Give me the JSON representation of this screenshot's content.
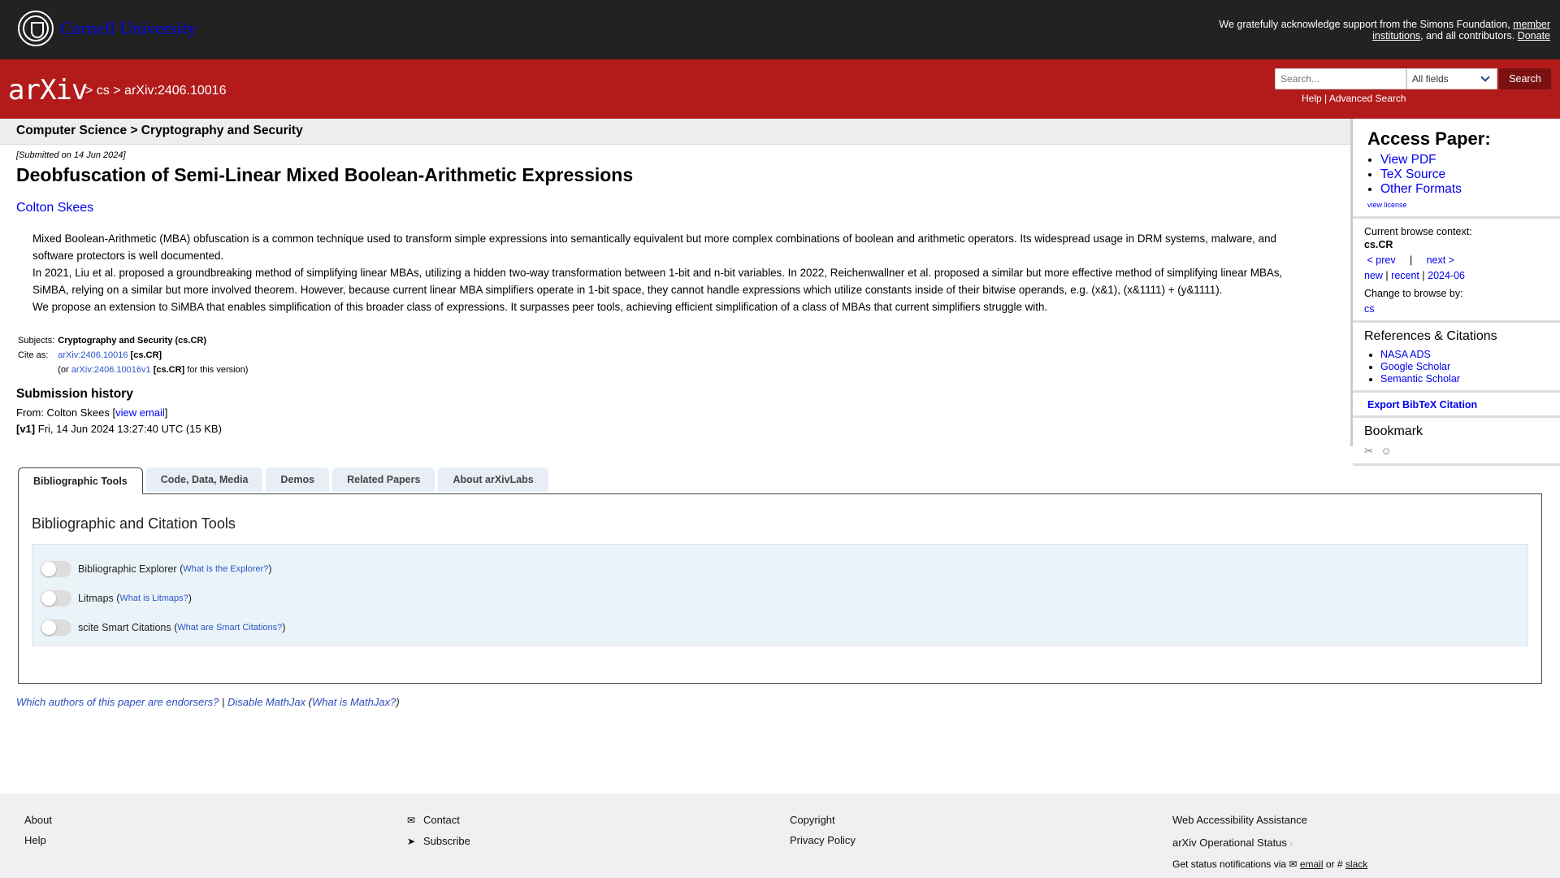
{
  "header": {
    "university": "Cornell University",
    "ack_text": "We gratefully acknowledge support from the Simons Foundation,",
    "ack_link1": "member institutions",
    "ack_mid": ", and all contributors.",
    "ack_donate": "Donate"
  },
  "topbar": {
    "logo": "arXiv",
    "crumb_sep1": ">",
    "crumb_cs": "cs",
    "crumb_sep2": ">",
    "crumb_id": "arXiv:2406.10016",
    "search_placeholder": "Search...",
    "search_field": "All fields",
    "search_button": "Search",
    "help": "Help",
    "help_sep": "|",
    "advanced": "Advanced Search"
  },
  "paper": {
    "category": "Computer Science > Cryptography and Security",
    "submitted": "[Submitted on 14 Jun 2024]",
    "title": "Deobfuscation of Semi-Linear Mixed Boolean-Arithmetic Expressions",
    "author": "Colton Skees",
    "abstract_p1": "Mixed Boolean-Arithmetic (MBA) obfuscation is a common technique used to transform simple expressions into semantically equivalent but more complex combinations of boolean and arithmetic operators. Its widespread usage in DRM systems, malware, and software protectors is well documented.",
    "abstract_p2": "In 2021, Liu et al. proposed a groundbreaking method of simplifying linear MBAs, utilizing a hidden two-way transformation between 1-bit and n-bit variables. In 2022, Reichenwallner et al. proposed a similar but more effective method of simplifying linear MBAs, SiMBA, relying on a similar but more involved theorem. However, because current linear MBA simplifiers operate in 1-bit space, they cannot handle expressions which utilize constants inside of their bitwise operands, e.g. (x&1), (x&1111) + (y&1111).",
    "abstract_p3": "We propose an extension to SiMBA that enables simplification of this broader class of expressions. It surpasses peer tools, achieving efficient simplification of a class of MBAs that current simplifiers struggle with.",
    "subjects_label": "Subjects:",
    "subjects_value": "Cryptography and Security (cs.CR)",
    "cite_label": "Cite as:",
    "cite_link": "arXiv:2406.10016",
    "cite_cat": "[cs.CR]",
    "cite_or_pre": "(or",
    "cite_version_link": "arXiv:2406.10016v1",
    "cite_version_cat": "[cs.CR]",
    "cite_or_post": "for this version)",
    "history_title": "Submission history",
    "history_from": "From: Colton Skees [",
    "history_view_email": "view email",
    "history_from_end": "]",
    "history_v1": "[v1]",
    "history_v1_text": "Fri, 14 Jun 2024 13:27:40 UTC (15 KB)"
  },
  "sidebar": {
    "access_title": "Access Paper:",
    "view_pdf": "View PDF",
    "tex_source": "TeX Source",
    "other_formats": "Other Formats",
    "view_license": "view license",
    "context_label": "Current browse context:",
    "context_value": "cs.CR",
    "prev": "< prev",
    "pipe": "|",
    "next": "next >",
    "new": "new",
    "recent": "recent",
    "date": "2024-06",
    "change_label": "Change to browse by:",
    "change_value": "cs",
    "refs_title": "References & Citations",
    "nasa": "NASA ADS",
    "google": "Google Scholar",
    "semantic": "Semantic Scholar",
    "bibtex": "Export BibTeX Citation",
    "bookmark": "Bookmark"
  },
  "tabs": {
    "items": [
      "Bibliographic Tools",
      "Code, Data, Media",
      "Demos",
      "Related Papers",
      "About arXivLabs"
    ],
    "panel_title": "Bibliographic and Citation Tools",
    "tool1": "Bibliographic Explorer",
    "tool1_link": "What is the Explorer?",
    "tool2": "Litmaps",
    "tool2_link": "What is Litmaps?",
    "tool3": "scite Smart Citations",
    "tool3_link": "What are Smart Citations?"
  },
  "endorse": {
    "link1": "Which authors of this paper are endorsers?",
    "sep": "|",
    "link2": "Disable MathJax",
    "link3": "What is MathJax?"
  },
  "footer": {
    "about": "About",
    "help": "Help",
    "contact": "Contact",
    "subscribe": "Subscribe",
    "copyright": "Copyright",
    "privacy": "Privacy Policy",
    "accessibility": "Web Accessibility Assistance",
    "status": "arXiv Operational Status",
    "notify": "Get status notifications via",
    "email": "email",
    "or": "or",
    "slack": "slack"
  },
  "colors": {
    "arxiv_red": "#b31b1b",
    "cornell_dark": "#222222",
    "search_button": "#7a1212",
    "link_blue": "#0000ee"
  }
}
